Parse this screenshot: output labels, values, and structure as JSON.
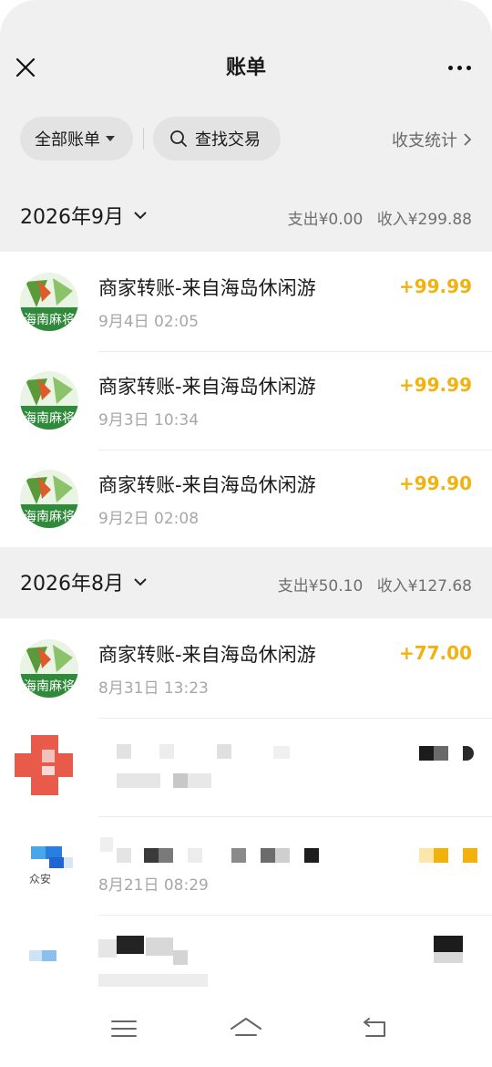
{
  "header": {
    "title": "账单",
    "filter_all_label": "全部账单",
    "search_label": "查找交易",
    "stats_link_label": "收支统计"
  },
  "months": [
    {
      "title": "2026年9月",
      "expense": "支出¥0.00",
      "income": "收入¥299.88",
      "transactions": [
        {
          "name": "商家转账-来自海岛休闲游",
          "time": "9月4日 02:05",
          "amount": "+99.99"
        },
        {
          "name": "商家转账-来自海岛休闲游",
          "time": "9月3日 10:34",
          "amount": "+99.99"
        },
        {
          "name": "商家转账-来自海岛休闲游",
          "time": "9月2日 02:08",
          "amount": "+99.90"
        }
      ]
    },
    {
      "title": "2026年8月",
      "expense": "支出¥50.10",
      "income": "收入¥127.68",
      "transactions": [
        {
          "name": "商家转账-来自海岛休闲游",
          "time": "8月31日 13:23",
          "amount": "+77.00"
        },
        {
          "name": "",
          "time": "",
          "amount": ""
        },
        {
          "name": "",
          "time": "8月21日 08:29",
          "amount": ""
        },
        {
          "name": "",
          "time": "",
          "amount": ""
        }
      ]
    }
  ],
  "avatar_logo_text": "海南麻将",
  "avatar_small_text": "众安",
  "colors": {
    "income": "#f2b20e",
    "header_bg": "#f0f0f0",
    "pill_bg": "#e3e3e3"
  },
  "icons": {
    "close": "close-icon",
    "more": "more-icon",
    "search": "search-icon",
    "chevron": "chevron-right-icon",
    "month_dropdown": "chevron-down-icon",
    "nav_menu": "menu-icon",
    "nav_home": "home-icon",
    "nav_back": "back-icon"
  }
}
